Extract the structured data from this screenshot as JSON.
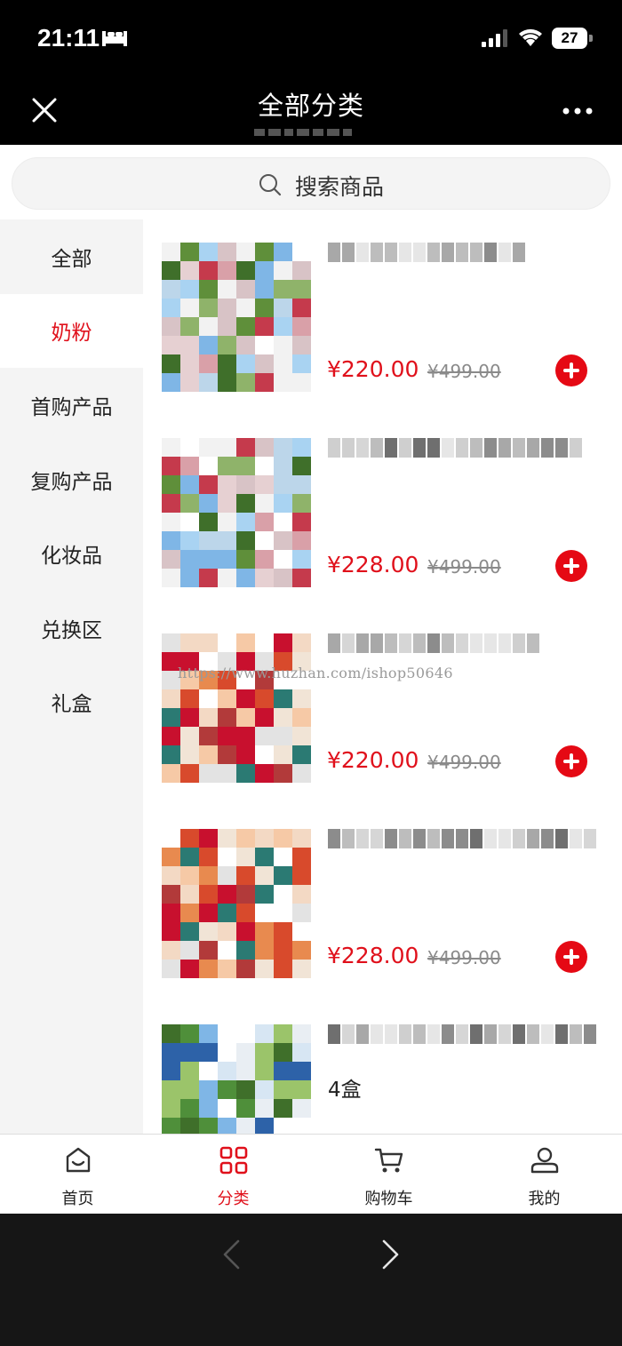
{
  "status": {
    "time": "21:11",
    "battery": "27"
  },
  "nav": {
    "title": "全部分类"
  },
  "search": {
    "placeholder": "搜索商品"
  },
  "sidebar": {
    "items": [
      {
        "label": "全部"
      },
      {
        "label": "奶粉"
      },
      {
        "label": "首购产品"
      },
      {
        "label": "复购产品"
      },
      {
        "label": "化妆品"
      },
      {
        "label": "兑换区"
      },
      {
        "label": "礼盒"
      }
    ],
    "active_index": 1
  },
  "products": [
    {
      "price": "¥220.00",
      "old_price": "¥499.00",
      "title_extra": ""
    },
    {
      "price": "¥228.00",
      "old_price": "¥499.00",
      "title_extra": ""
    },
    {
      "price": "¥220.00",
      "old_price": "¥499.00",
      "title_extra": ""
    },
    {
      "price": "¥228.00",
      "old_price": "¥499.00",
      "title_extra": ""
    },
    {
      "price": "",
      "old_price": "",
      "title_extra": "4盒"
    }
  ],
  "watermark": "https://www.huzhan.com/ishop50646",
  "tabbar": {
    "items": [
      {
        "label": "首页",
        "icon": "home-icon"
      },
      {
        "label": "分类",
        "icon": "category-icon"
      },
      {
        "label": "购物车",
        "icon": "cart-icon"
      },
      {
        "label": "我的",
        "icon": "user-icon"
      }
    ],
    "active_index": 1
  },
  "colors": {
    "accent": "#e0101b",
    "nav_bg": "#000000",
    "sidebar_bg": "#f4f4f4"
  }
}
